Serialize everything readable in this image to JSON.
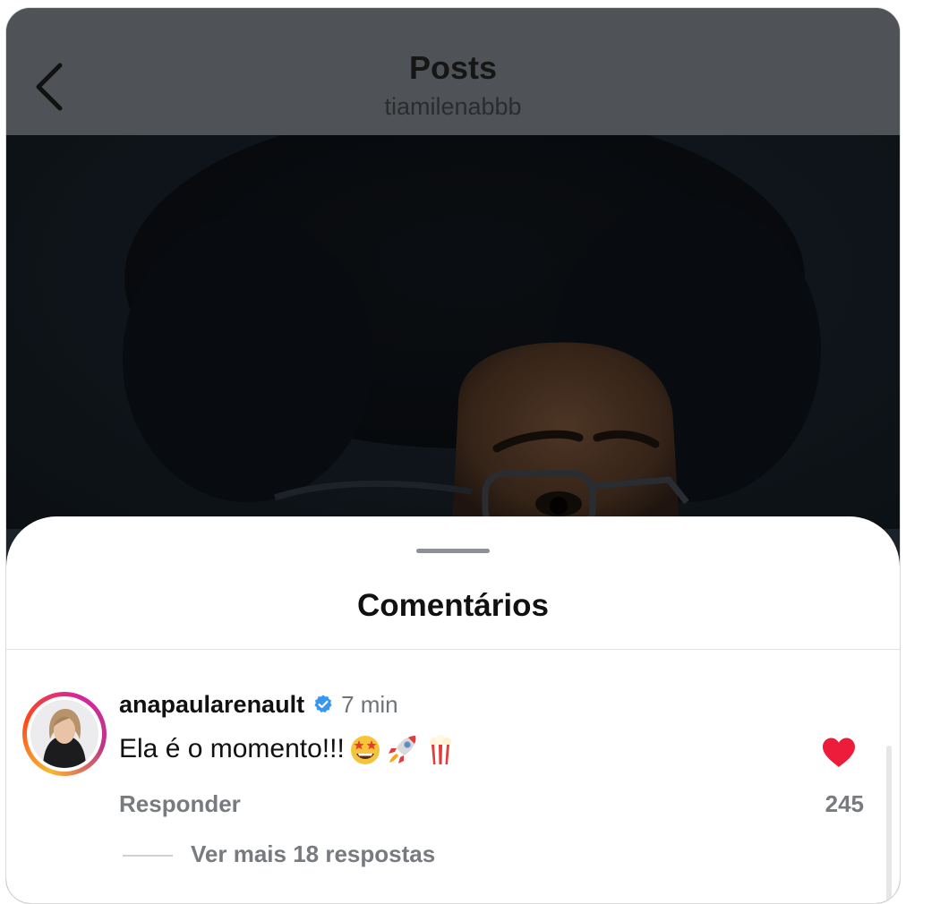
{
  "header": {
    "title": "Posts",
    "subtitle": "tiamilenabbb"
  },
  "sheet": {
    "title": "Comentários"
  },
  "comment": {
    "username": "anapaularenault",
    "verified": true,
    "time": "7 min",
    "text": "Ela é o momento!!!",
    "emojis": [
      "star-struck-emoji",
      "rocket-emoji",
      "popcorn-emoji"
    ],
    "reply_label": "Responder",
    "liked": true,
    "like_count": "245",
    "view_replies_label": "Ver mais 18 respostas"
  },
  "colors": {
    "header_bg": "#4f5357",
    "heart": "#ed1c3a",
    "verified": "#3897f0",
    "muted_text": "#777b80"
  }
}
